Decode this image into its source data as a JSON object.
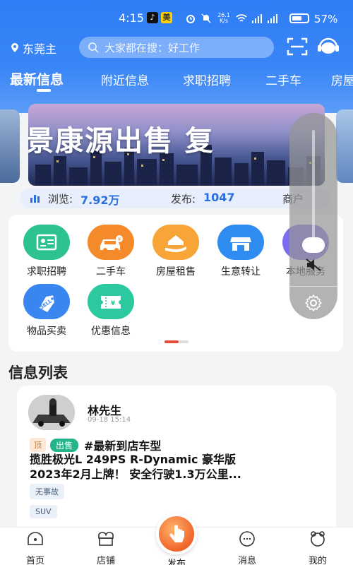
{
  "status_bar": {
    "time": "4:15",
    "apps": [
      "tiktok-icon",
      "meituan-icon"
    ],
    "net_speed": "26.1\nK/s",
    "battery": "57%"
  },
  "header": {
    "location": "东莞主",
    "search_placeholder": "大家都在搜：好工作",
    "tabs": [
      {
        "label": "最新信息",
        "active": true
      },
      {
        "label": "附近信息"
      },
      {
        "label": "求职招聘"
      },
      {
        "label": "二手车"
      },
      {
        "label": "房屋"
      }
    ],
    "accent_color": "#2f7df6"
  },
  "banner": {
    "text": "景康源出售  复"
  },
  "stats": {
    "browse_label": "浏览:",
    "browse_value": "7.92万",
    "publish_label": "发布:",
    "publish_value": "1047",
    "merchant_label": "商户"
  },
  "categories": [
    {
      "label": "求职招聘",
      "icon": "id-card-icon",
      "color": "#2cc38f"
    },
    {
      "label": "二手车",
      "icon": "car-icon",
      "color": "#f58a2a"
    },
    {
      "label": "房屋租售",
      "icon": "house-hand-icon",
      "color": "#f7a537"
    },
    {
      "label": "生意转让",
      "icon": "shop-icon",
      "color": "#2f8cf0"
    },
    {
      "label": "本地服务",
      "icon": "service-icon",
      "color": "#7b6ef0"
    },
    {
      "label": "物品买卖",
      "icon": "sell-tag-icon",
      "color": "#3a86f0"
    },
    {
      "label": "优惠信息",
      "icon": "coupon-icon",
      "color": "#2cc9a0"
    }
  ],
  "list": {
    "title": "信息列表",
    "post": {
      "name": "林先生",
      "time": "09-18 15:14",
      "tag_top": "顶",
      "tag_sell": "出售",
      "topic": "#最新到店车型",
      "line1": "揽胜极光L 249PS R-Dynamic 豪华版",
      "line2": "2023年2月上牌！ 安全行驶1.3万公里...",
      "chips": [
        "无事故",
        "SUV"
      ]
    }
  },
  "bottom_nav": {
    "home": "首页",
    "shop": "店铺",
    "publish": "发布",
    "messages": "消息",
    "mine": "我的"
  },
  "volume_overlay": {
    "level": 0.05,
    "muted": true
  }
}
